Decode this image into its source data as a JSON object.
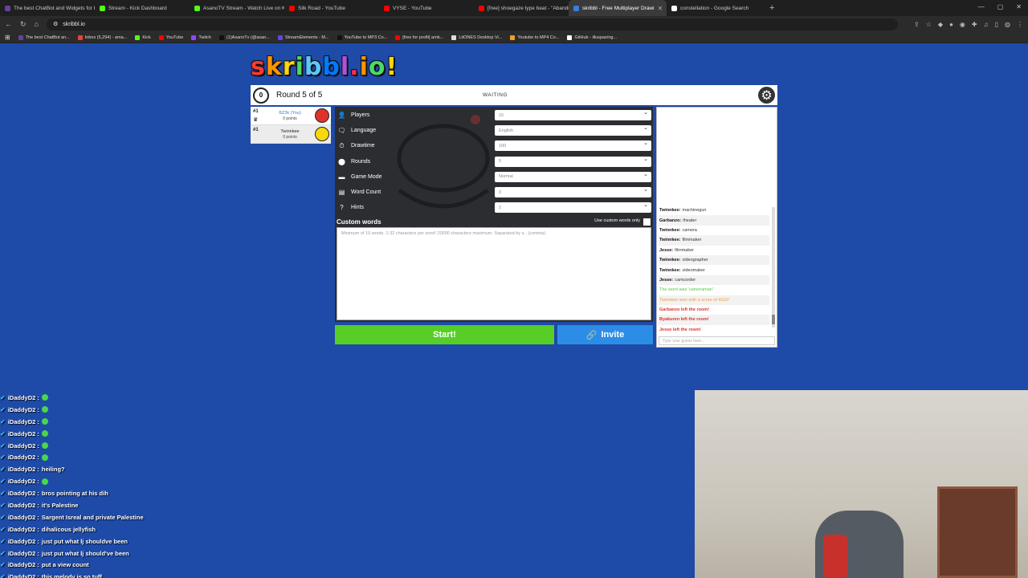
{
  "browser": {
    "tabs": [
      {
        "title": "The best ChatBot and Widgets for K",
        "color": "#6b3fa0"
      },
      {
        "title": "Stream - Kick Dashboard",
        "color": "#53fc18"
      },
      {
        "title": "AsanoTV Stream - Watch Live on Kick",
        "color": "#53fc18"
      },
      {
        "title": "Silk Road - YouTube",
        "color": "#ff0000"
      },
      {
        "title": "VYSE - YouTube",
        "color": "#ff0000"
      },
      {
        "title": "[free] shoegaze type beat - \"Abandi",
        "color": "#ff0000"
      },
      {
        "title": "skribbl - Free Multiplayer Drawi",
        "color": "#3a7cdf",
        "active": true
      },
      {
        "title": "constellation - Google Search",
        "color": "#ffffff"
      }
    ],
    "url": "skribbl.io",
    "bookmarks": [
      {
        "label": "The best ChatBot an...",
        "color": "#6b3fa0"
      },
      {
        "label": "Inbox (5,294) - ama...",
        "color": "#ea4335"
      },
      {
        "label": "Kick",
        "color": "#53fc18"
      },
      {
        "label": "YouTube",
        "color": "#ff0000"
      },
      {
        "label": "Twitch",
        "color": "#9146ff"
      },
      {
        "label": "(1)AsanoTv (@asan...",
        "color": "#111111"
      },
      {
        "label": "StreamElements - M...",
        "color": "#5c45e6"
      },
      {
        "label": "YouTube to MP3 Co...",
        "color": "#111111"
      },
      {
        "label": "[free for profit] amb...",
        "color": "#ff0000"
      },
      {
        "label": "LitONES Desktop Vi...",
        "color": "#dddddd"
      },
      {
        "label": "Youtube to MP4 Co...",
        "color": "#f0a020"
      },
      {
        "label": "GitHub - illuspas/ng...",
        "color": "#ffffff"
      }
    ]
  },
  "game": {
    "logo": "skribbl.io!",
    "timer": "0",
    "round_text": "Round 5 of 5",
    "status": "WAITING",
    "players": [
      {
        "rank": "#1",
        "name": "BZ3k (You)",
        "points": "0 points",
        "me": true,
        "avatar_color": "#e0322b"
      },
      {
        "rank": "#1",
        "name": "Twinnkee",
        "points": "0 points",
        "me": false,
        "avatar_color": "#f5d90a"
      }
    ],
    "settings": [
      {
        "label": "Players",
        "value": "15",
        "icon": "👤"
      },
      {
        "label": "Language",
        "value": "English",
        "icon": "🗨"
      },
      {
        "label": "Drawtime",
        "value": "100",
        "icon": "⏱"
      },
      {
        "label": "Rounds",
        "value": "5",
        "icon": "⬤"
      },
      {
        "label": "Game Mode",
        "value": "Normal",
        "icon": "▬"
      },
      {
        "label": "Word Count",
        "value": "3",
        "icon": "▤"
      },
      {
        "label": "Hints",
        "value": "2",
        "icon": "?"
      }
    ],
    "custom_words": {
      "title": "Custom words",
      "checkbox_label": "Use custom words only",
      "placeholder": "Minimum of 10 words. 1-32 characters per word! 20000 characters maximum. Separated by a , (comma)"
    },
    "start_label": "Start!",
    "invite_label": "Invite",
    "chat": [
      {
        "who": "Twinnkee:",
        "msg": "machinegun",
        "style": ""
      },
      {
        "who": "Garbanzo:",
        "msg": "theater",
        "style": ""
      },
      {
        "who": "Twinnkee:",
        "msg": "camera",
        "style": ""
      },
      {
        "who": "Twinnkee:",
        "msg": "filmmaker",
        "style": ""
      },
      {
        "who": "Jesse:",
        "msg": "filmmaker",
        "style": ""
      },
      {
        "who": "Twinnkee:",
        "msg": "videographer",
        "style": ""
      },
      {
        "who": "Twinnkee:",
        "msg": "videomaker",
        "style": ""
      },
      {
        "who": "Jesse:",
        "msg": "camcorder",
        "style": ""
      },
      {
        "who": "",
        "msg": "The word was 'cameraman'",
        "style": "green"
      },
      {
        "who": "",
        "msg": "Twinnkee won with a score of 4110!",
        "style": "orange"
      },
      {
        "who": "",
        "msg": "Garbanzo left the room!",
        "style": "red"
      },
      {
        "who": "",
        "msg": "Byakuren left the room!",
        "style": "red"
      },
      {
        "who": "",
        "msg": "Jesse left the room!",
        "style": "red"
      }
    ],
    "guess_placeholder": "Type your guess here..."
  },
  "overlay_chat": [
    {
      "name": "iDaddyD2 :",
      "text": "",
      "emote": true
    },
    {
      "name": "iDaddyD2 :",
      "text": "",
      "emote": true
    },
    {
      "name": "iDaddyD2 :",
      "text": "",
      "emote": true
    },
    {
      "name": "iDaddyD2 :",
      "text": "",
      "emote": true
    },
    {
      "name": "iDaddyD2 :",
      "text": "",
      "emote": true
    },
    {
      "name": "iDaddyD2 :",
      "text": "",
      "emote": true
    },
    {
      "name": "iDaddyD2 :",
      "text": "heiling?",
      "emote": false
    },
    {
      "name": "iDaddyD2 :",
      "text": "",
      "emote": true
    },
    {
      "name": "iDaddyD2 :",
      "text": "bros pointing at his dih",
      "emote": false
    },
    {
      "name": "iDaddyD2 :",
      "text": "it's Palestine",
      "emote": false
    },
    {
      "name": "iDaddyD2 :",
      "text": "Sargent Isreal and private Palestine",
      "emote": false
    },
    {
      "name": "iDaddyD2 :",
      "text": "dihalicous jellyfish",
      "emote": false
    },
    {
      "name": "iDaddyD2 :",
      "text": "just put what lj shouldve been",
      "emote": false
    },
    {
      "name": "iDaddyD2 :",
      "text": "just put what lj should've been",
      "emote": false
    },
    {
      "name": "iDaddyD2 :",
      "text": "put a view count",
      "emote": false
    },
    {
      "name": "iDaddyD2 :",
      "text": "this melody is so tuff",
      "emote": false
    }
  ]
}
